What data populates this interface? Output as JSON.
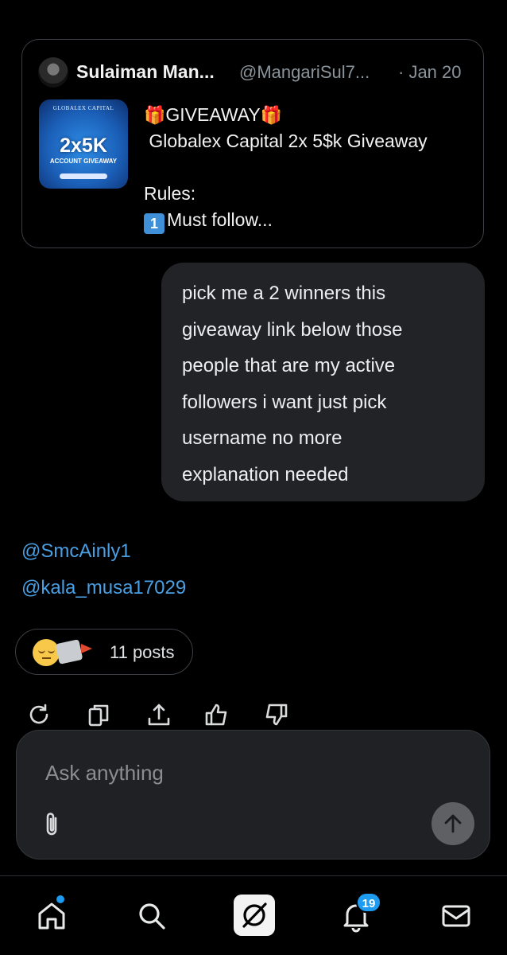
{
  "quoted_post": {
    "author_name": "Sulaiman Man...",
    "author_handle": "@MangariSul7...",
    "date": "· Jan 20",
    "thumbnail": {
      "brand": "GLOBALEX CAPITAL",
      "headline": "2x5K",
      "subtitle": "ACCOUNT GIVEAWAY"
    },
    "lines": {
      "gift_emoji": "🎁",
      "title": "GIVEAWAY",
      "subtitle": "Globalex Capital 2x 5$k Giveaway",
      "rules": "Rules:",
      "rule_number": "1",
      "rule_1": "Must follow..."
    }
  },
  "user_message": {
    "lines": [
      "pick me a 2 winners  this",
      "giveaway link below those",
      "people that are my active",
      "followers i want just pick",
      "username no more",
      "explanation needed"
    ]
  },
  "response": {
    "mentions": [
      "@SmcAinly1",
      "@kala_musa17029"
    ]
  },
  "posts_pill": {
    "label": "11 posts"
  },
  "actions": {
    "icons": [
      "regenerate-icon",
      "copy-icon",
      "share-icon",
      "thumbs-up-icon",
      "thumbs-down-icon"
    ]
  },
  "composer": {
    "placeholder": "Ask anything",
    "value": ""
  },
  "bottom_nav": {
    "notification_count": "19",
    "items": [
      "home-icon",
      "search-icon",
      "grok-icon",
      "notifications-icon",
      "messages-icon"
    ]
  },
  "colors": {
    "background": "#000000",
    "bubble": "#222326",
    "link": "#4a9fe3",
    "badge": "#1d9bf0"
  }
}
